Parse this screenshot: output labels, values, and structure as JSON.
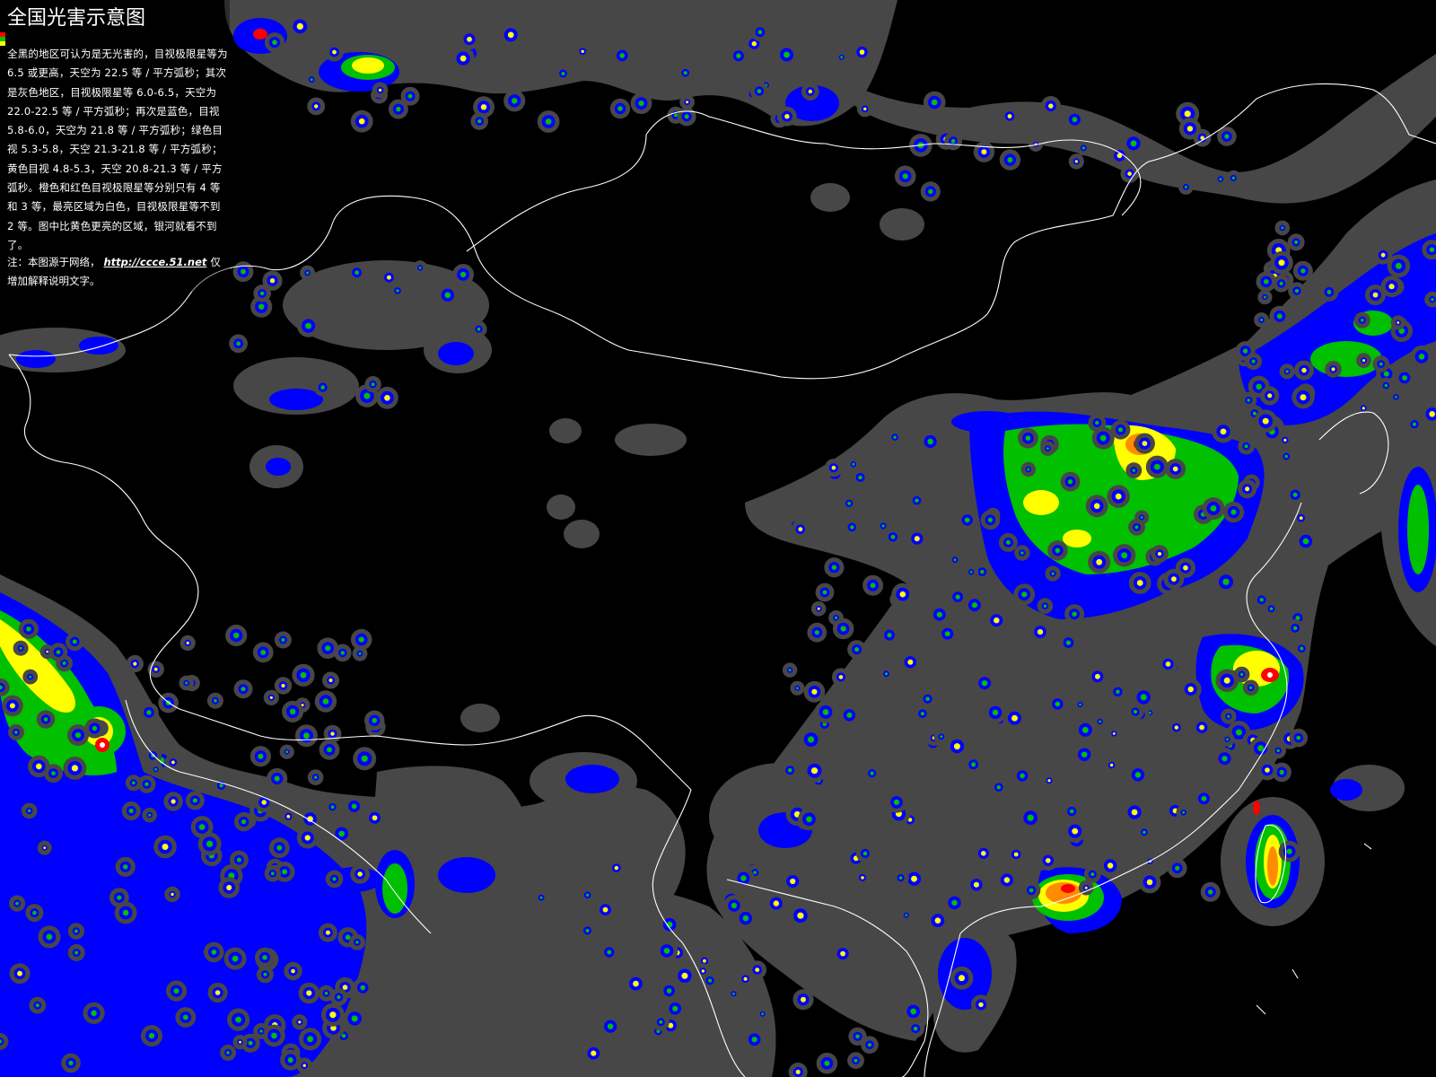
{
  "map": {
    "title": "全国光害示意图",
    "description": "全黑的地区可认为是无光害的，目视极限星等为 6.5 或更高，天空为 22.5 等 / 平方弧秒；其次是灰色地区，目视极限星等 6.0-6.5，天空为 22.0-22.5 等 / 平方弧秒；再次是蓝色，目视 5.8-6.0，天空为 21.8 等 / 平方弧秒；绿色目视 5.3-5.8，天空 21.3-21.8 等 / 平方弧秒；黄色目视 4.8-5.3，天空 20.8-21.3 等 / 平方弧秒。橙色和红色目视极限星等分别只有 4 等和 3 等，最亮区域为白色，目视极限星等不到 2 等。图中比黄色更亮的区域，银河就看不到了。",
    "note_prefix": "注：本图源于网络，",
    "source_link": "http://ccce.51.net",
    "note_suffix": "仅增加解释说明文字。"
  },
  "legend_colors": {
    "black": "#000000",
    "gray": "#474747",
    "blue": "#0000ff",
    "green": "#00c000",
    "yellow": "#ffff00",
    "orange": "#ff8c00",
    "red": "#ff0000",
    "white": "#ffffff"
  },
  "border_color": "#ffffff"
}
